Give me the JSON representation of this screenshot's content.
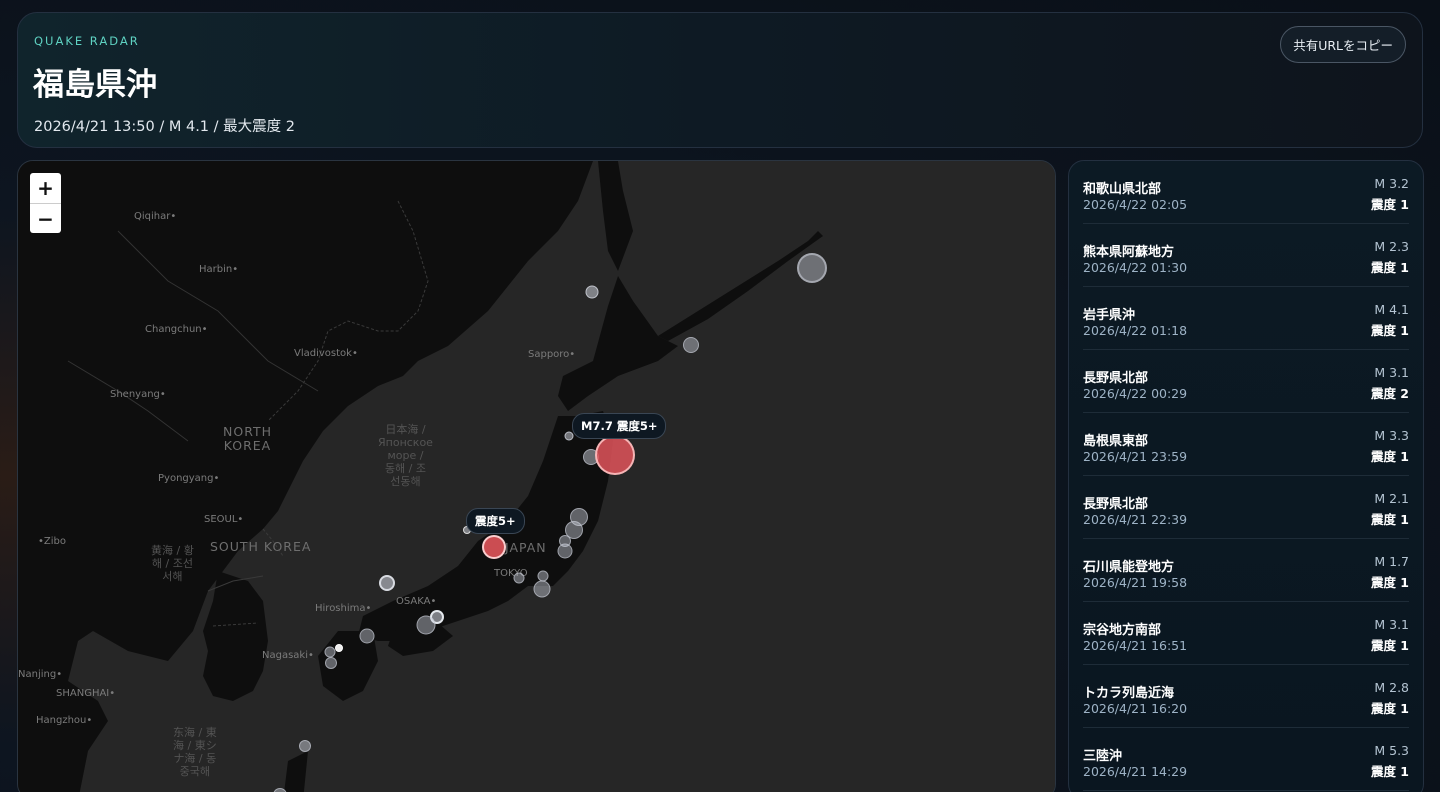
{
  "header": {
    "brand": "QUAKE RADAR",
    "title": "福島県沖",
    "subtitle": "2026/4/21 13:50 / M 4.1 / 最大震度 2",
    "share_button": "共有URLをコピー"
  },
  "map": {
    "zoom_in": "+",
    "zoom_out": "−",
    "labels": {
      "qiqihar": "Qiqihar•",
      "harbin": "Harbin•",
      "changchun": "Changchun•",
      "vladivostok": "Vladivostok•",
      "shenyang": "Shenyang•",
      "sapporo": "Sapporo•",
      "pyongyang": "Pyongyang•",
      "seoul": "SEOUL•",
      "zibo": "•Zibo",
      "hiroshima": "Hiroshima•",
      "osaka": "OSAKA•",
      "tokyo": "TOKYO",
      "nagasaki": "Nagasaki•",
      "nanjing": "Nanjing•",
      "shanghai": "SHANGHAI•",
      "hangzhou": "Hangzhou•",
      "north_korea": "NORTH\nKOREA",
      "south_korea": "SOUTH KOREA",
      "japan": "JAPAN",
      "sea_of_japan": "日本海 /\nЯпонское\nморе /\n동해 / 조\n선동해",
      "yellow_sea": "黄海 / 황\n해 / 조선\n서해",
      "east_china_sea": "东海 / 東\n海 / 東シ\nナ海 / 동\n중국해"
    },
    "tooltips": {
      "big": "M7.7 震度5+",
      "central": "震度5+"
    },
    "colors": {
      "highlight": "#e0545a",
      "marker": "#c9ccd6"
    }
  },
  "quakes": [
    {
      "place": "和歌山県北部",
      "time": "2026/4/22 02:05",
      "mag": "M 3.2",
      "shindo": "震度 1"
    },
    {
      "place": "熊本県阿蘇地方",
      "time": "2026/4/22 01:30",
      "mag": "M 2.3",
      "shindo": "震度 1"
    },
    {
      "place": "岩手県沖",
      "time": "2026/4/22 01:18",
      "mag": "M 4.1",
      "shindo": "震度 1"
    },
    {
      "place": "長野県北部",
      "time": "2026/4/22 00:29",
      "mag": "M 3.1",
      "shindo": "震度 2"
    },
    {
      "place": "島根県東部",
      "time": "2026/4/21 23:59",
      "mag": "M 3.3",
      "shindo": "震度 1"
    },
    {
      "place": "長野県北部",
      "time": "2026/4/21 22:39",
      "mag": "M 2.1",
      "shindo": "震度 1"
    },
    {
      "place": "石川県能登地方",
      "time": "2026/4/21 19:58",
      "mag": "M 1.7",
      "shindo": "震度 1"
    },
    {
      "place": "宗谷地方南部",
      "time": "2026/4/21 16:51",
      "mag": "M 3.1",
      "shindo": "震度 1"
    },
    {
      "place": "トカラ列島近海",
      "time": "2026/4/21 16:20",
      "mag": "M 2.8",
      "shindo": "震度 1"
    },
    {
      "place": "三陸沖",
      "time": "2026/4/21 14:29",
      "mag": "M 5.3",
      "shindo": "震度 1"
    }
  ]
}
